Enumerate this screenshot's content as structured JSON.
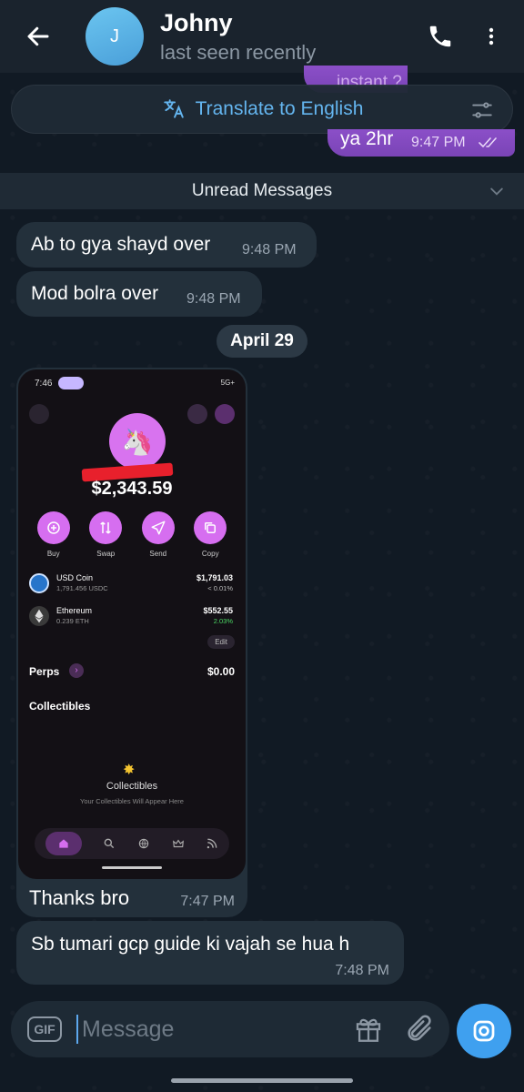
{
  "header": {
    "avatar_letter": "J",
    "contact_name": "Johny",
    "status": "last seen recently"
  },
  "translate_bar": {
    "label": "Translate to English"
  },
  "messages_top": [
    {
      "text": "instant ?",
      "direction": "out"
    },
    {
      "text": "ya 2hr",
      "time": "9:47 PM",
      "direction": "out",
      "read": true
    }
  ],
  "unread_bar": {
    "label": "Unread Messages"
  },
  "messages_incoming": [
    {
      "text": "Ab to gya shayd over",
      "time": "9:48 PM"
    },
    {
      "text": "Mod bolra over",
      "time": "9:48 PM"
    }
  ],
  "date_pill": "April 29",
  "photo_message": {
    "caption": "Thanks bro",
    "time": "7:47 PM",
    "screenshot": {
      "clock": "7:46",
      "signal_text": "5G+",
      "balance": "$2,343.59",
      "actions": [
        "Buy",
        "Swap",
        "Send",
        "Copy"
      ],
      "assets": [
        {
          "name": "USD Coin",
          "amount": "1,791.456 USDC",
          "value": "$1,791.03",
          "change": "< 0.01%",
          "color": "#2775ca"
        },
        {
          "name": "Ethereum",
          "amount": "0.239 ETH",
          "value": "$552.55",
          "change": "2.03%",
          "color": "#3a3a3a",
          "change_color": "#4cd964"
        }
      ],
      "edit_label": "Edit",
      "perps_label": "Perps",
      "perps_value": "$0.00",
      "collectibles_heading": "Collectibles",
      "collectibles_title": "Collectibles",
      "collectibles_sub": "Your Collectibles Will Appear Here"
    }
  },
  "last_message": {
    "text": "Sb tumari gcp guide ki vajah se hua h",
    "time": "7:48 PM"
  },
  "composer": {
    "placeholder": "Message",
    "gif_label": "GIF"
  },
  "colors": {
    "accent": "#3fa0ef",
    "outgoing_bubble": "#7a44b6",
    "incoming_bubble": "#23303b"
  }
}
